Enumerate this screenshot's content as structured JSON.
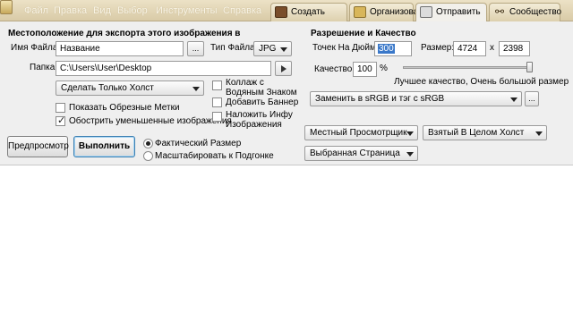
{
  "menu": {
    "items": [
      "Файл",
      "Правка",
      "Вид",
      "Выбор",
      "Инструменты",
      "Справка"
    ],
    "tabs": [
      {
        "label": "Создать"
      },
      {
        "label": "Организовать"
      },
      {
        "label": "Отправить"
      },
      {
        "label": "Сообщество"
      }
    ]
  },
  "export": {
    "section_title": "Местоположение для экспорта этого изображения в",
    "filename_label": "Имя Файла:",
    "filename_value": "Название",
    "browse_label": "...",
    "filetype_label": "Тип Файла:",
    "filetype_value": "JPG",
    "folder_label": "Папка:",
    "folder_value": "C:\\Users\\User\\Desktop",
    "scope_value": "Сделать Только Холст",
    "show_crop_marks": "Показать Обрезные Метки",
    "sharpen_downscaled": "Обострить уменьшенные изображения",
    "watermark_collage": "Коллаж с Водяным Знаком",
    "add_banner": "Добавить Баннер",
    "overlay_info": "Наложить Инфу Изображения"
  },
  "resolution": {
    "section_title": "Разрешение и Качество",
    "dpi_label": "Точек На Дюйм:",
    "dpi_value": "300",
    "size_label": "Размер:",
    "width_value": "4724",
    "x_label": "x",
    "height_value": "2398",
    "quality_label": "Качество:",
    "quality_value": "100",
    "percent": "%",
    "quality_level": 1.0,
    "quality_hint": "Лучшее качество, Очень большой размер",
    "color_profile": "Заменить в sRGB и тэг с sRGB",
    "color_more": "..."
  },
  "bottom": {
    "preview_button": "Предпросмотр",
    "run_button": "Выполнить",
    "actual_size": "Фактический Размер",
    "fit_scale": "Масштабировать к Подгонке",
    "viewer_value": "Местный Просмотрщик",
    "canvas_value": "Взятый В Целом Холст",
    "page_value": "Выбранная Страница"
  },
  "colors": {
    "menubar": "#d9cba7",
    "panel": "#efefef",
    "primary_border": "#3c7fb1"
  }
}
